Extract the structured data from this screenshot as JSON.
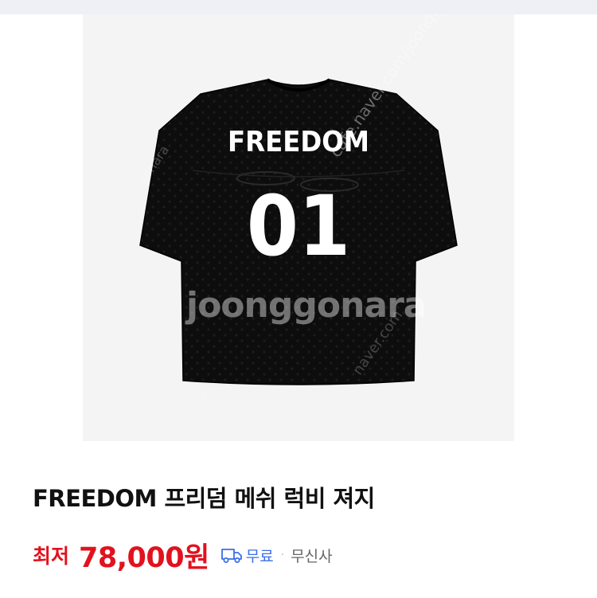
{
  "product": {
    "image": {
      "jersey_print_word": "FREEDOM",
      "jersey_print_number": "01",
      "watermark_main": "joonggonara",
      "watermark_url": "cafe.naver.com/joonggonara",
      "watermark_url_short": "naver.com",
      "watermark_small": "gonara",
      "watermark_small2": "ara"
    },
    "expand_icon": "expand-arrows-icon",
    "title": "FREEDOM 프리덤 메쉬 럭비 져지",
    "price_label": "최저",
    "price_value": "78,000원",
    "shipping_icon": "delivery-truck-icon",
    "shipping_label": "무료",
    "separator": "·",
    "seller": "무신사"
  },
  "colors": {
    "price_red": "#e1121e",
    "shipping_blue": "#3b6fe6",
    "image_bg": "#f4f4f4",
    "jersey": "#0d0d0d"
  }
}
